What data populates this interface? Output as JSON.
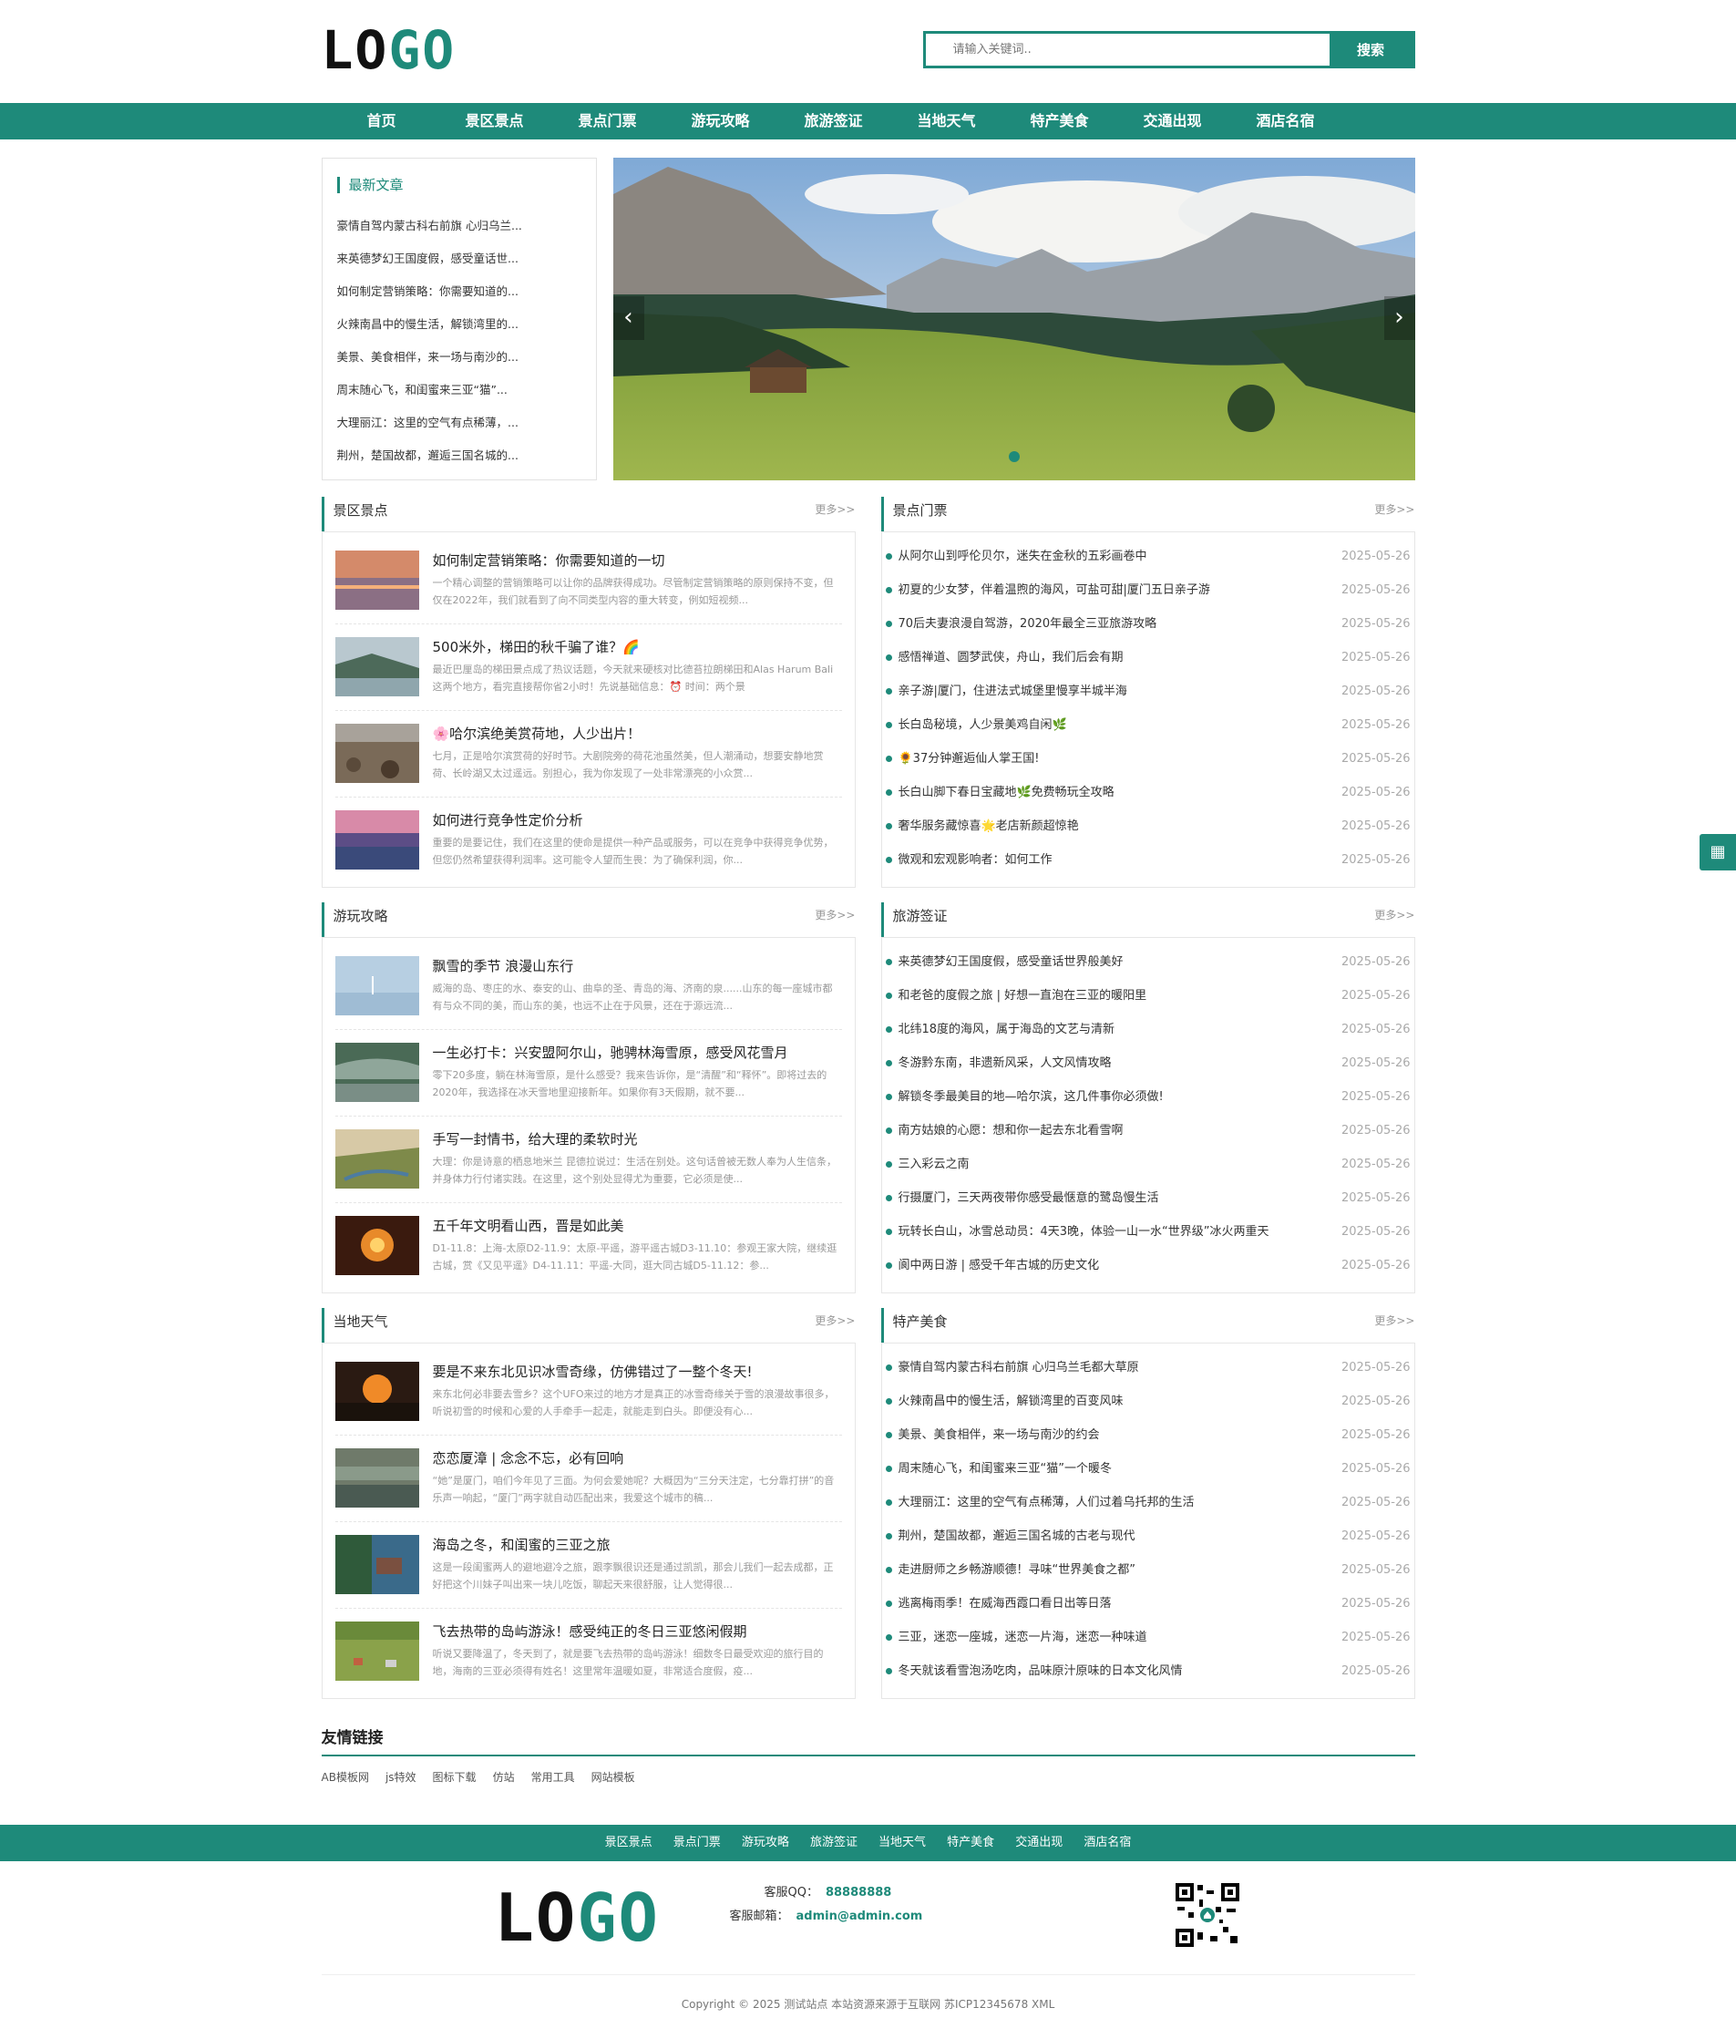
{
  "header": {
    "logo_dark": "LO",
    "logo_accent": "GO",
    "search_placeholder": "请输入关键词..",
    "search_button": "搜索"
  },
  "nav": [
    "首页",
    "景区景点",
    "景点门票",
    "游玩攻略",
    "旅游签证",
    "当地天气",
    "特产美食",
    "交通出现",
    "酒店名宿"
  ],
  "latest": {
    "title": "最新文章",
    "items": [
      "豪情自驾内蒙古科右前旗 心归乌兰...",
      "来英德梦幻王国度假，感受童话世...",
      "如何制定营销策略：你需要知道的...",
      "火辣南昌中的慢生活，解锁湾里的...",
      "美景、美食相伴，来一场与南沙的...",
      "周末随心飞，和闺蜜来三亚“猫”...",
      "大理丽江：这里的空气有点稀薄，...",
      "荆州，楚国故都，邂逅三国名城的..."
    ]
  },
  "more": "更多>>",
  "sections": {
    "scenic": {
      "title": "景区景点",
      "articles": [
        {
          "title": "如何制定营销策略：你需要知道的一切",
          "desc": "一个精心调整的营销策略可以让你的品牌获得成功。尽管制定营销策略的原则保持不变，但仅在2022年，我们就看到了向不同类型内容的重大转变，例如短视频..."
        },
        {
          "title": "500米外，梯田的秋千骗了谁？🌈",
          "desc": "最近巴厘岛的梯田景点成了热议话题，今天就来硬核对比德苔拉朗梯田和Alas Harum Bali这两个地方，看完直接帮你省2小时！先说基础信息：⏰ 时间：两个景"
        },
        {
          "title": "🌸哈尔滨绝美赏荷地，人少出片！",
          "desc": "七月，正是哈尔滨赏荷的好时节。大剧院旁的荷花池虽然美，但人潮涌动，想要安静地赏荷、长岭湖又太过遥远。别担心，我为你发现了一处非常漂亮的小众赏..."
        },
        {
          "title": "如何进行竞争性定价分析",
          "desc": "重要的是要记住，我们在这里的使命是提供一种产品或服务，可以在竞争中获得竞争优势，但您仍然希望获得利润率。这可能令人望而生畏：为了确保利润，你..."
        }
      ]
    },
    "tickets": {
      "title": "景点门票",
      "items": [
        {
          "t": "从阿尔山到呼伦贝尔，迷失在金秋的五彩画卷中",
          "d": "2025-05-26"
        },
        {
          "t": "初夏的少女梦，伴着温煦的海风，可盐可甜|厦门五日亲子游",
          "d": "2025-05-26"
        },
        {
          "t": "70后夫妻浪漫自驾游，2020年最全三亚旅游攻略",
          "d": "2025-05-26"
        },
        {
          "t": "感悟禅道、圆梦武侠，舟山，我们后会有期",
          "d": "2025-05-26"
        },
        {
          "t": "亲子游|厦门，住进法式城堡里慢享半城半海",
          "d": "2025-05-26"
        },
        {
          "t": "长白岛秘境，人少景美鸡自闲🌿",
          "d": "2025-05-26"
        },
        {
          "t": "🌻37分钟邂逅仙人掌王国!",
          "d": "2025-05-26"
        },
        {
          "t": "长白山脚下春日宝藏地🌿免费畅玩全攻略",
          "d": "2025-05-26"
        },
        {
          "t": "奢华服务藏惊喜🌟老店新颜超惊艳",
          "d": "2025-05-26"
        },
        {
          "t": "微观和宏观影响者：如何工作",
          "d": "2025-05-26"
        }
      ]
    },
    "guide": {
      "title": "游玩攻略",
      "articles": [
        {
          "title": "飘雪的季节 浪漫山东行",
          "desc": "威海的岛、枣庄的水、泰安的山、曲阜的圣、青岛的海、济南的泉......山东的每一座城市都有与众不同的美，而山东的美，也远不止在于风景，还在于源远流..."
        },
        {
          "title": "一生必打卡：兴安盟阿尔山，驰骋林海雪原，感受风花雪月",
          "desc": "零下20多度，躺在林海雪原，是什么感受？我来告诉你，是“清醒”和“释怀”。即将过去的2020年，我选择在冰天雪地里迎接新年。如果你有3天假期，就不要..."
        },
        {
          "title": "手写一封情书，给大理的柔软时光",
          "desc": "大理：你是诗意的栖息地米兰 昆德拉说过：生活在别处。这句话曾被无数人奉为人生信条，并身体力行付诸实践。在这里，这个别处显得尤为重要，它必须是使..."
        },
        {
          "title": "五千年文明看山西，晋是如此美",
          "desc": "D1-11.8：上海-太原D2-11.9：太原-平遥，游平遥古城D3-11.10：参观王家大院，继续逛古城，赏《又见平遥》D4-11.11：平遥-大同，逛大同古城D5-11.12：参..."
        }
      ]
    },
    "visa": {
      "title": "旅游签证",
      "items": [
        {
          "t": "来英德梦幻王国度假，感受童话世界般美好",
          "d": "2025-05-26"
        },
        {
          "t": "和老爸的度假之旅 | 好想一直泡在三亚的暖阳里",
          "d": "2025-05-26"
        },
        {
          "t": "北纬18度的海风，属于海岛的文艺与清新",
          "d": "2025-05-26"
        },
        {
          "t": "冬游黔东南，非遗新风采，人文风情攻略",
          "d": "2025-05-26"
        },
        {
          "t": "解锁冬季最美目的地—哈尔滨，这几件事你必须做!",
          "d": "2025-05-26"
        },
        {
          "t": "南方姑娘的心愿：想和你一起去东北看雪啊",
          "d": "2025-05-26"
        },
        {
          "t": "三入彩云之南",
          "d": "2025-05-26"
        },
        {
          "t": "行摄厦门，三天两夜带你感受最惬意的鹭岛慢生活",
          "d": "2025-05-26"
        },
        {
          "t": "玩转长白山，冰雪总动员：4天3晚，体验一山一水“世界级”冰火两重天",
          "d": "2025-05-26"
        },
        {
          "t": "阆中两日游 | 感受千年古城的历史文化",
          "d": "2025-05-26"
        }
      ]
    },
    "weather": {
      "title": "当地天气",
      "articles": [
        {
          "title": "要是不来东北见识冰雪奇缘，仿佛错过了一整个冬天!",
          "desc": "来东北何必非要去雪乡？这个UFO来过的地方才是真正的冰雪奇缘关于雪的浪漫故事很多，听说初雪的时候和心爱的人手牵手一起走，就能走到白头。即便没有心..."
        },
        {
          "title": "恋恋厦漳 | 念念不忘，必有回响",
          "desc": "“她”是厦门，咱们今年见了三面。为何会爱她呢？大概因为“三分天注定，七分靠打拼”的音乐声一响起，“厦门”两字就自动匹配出来，我爱这个城市的稿..."
        },
        {
          "title": "海岛之冬，和闺蜜的三亚之旅",
          "desc": "这是一段闺蜜两人的避地避冷之旅，跟李飘很识还是通过凯凯，那会儿我们一起去成都，正好把这个川妹子叫出来一块儿吃饭，聊起天来很舒服，让人觉得很..."
        },
        {
          "title": "飞去热带的岛屿游泳！感受纯正的冬日三亚悠闲假期",
          "desc": "听说又要降温了，冬天到了，就是要飞去热带的岛屿游泳！细数冬日最受欢迎的旅行目的地，海南的三亚必须得有姓名！这里常年温暖如夏，非常适合度假，疫..."
        }
      ]
    },
    "food": {
      "title": "特产美食",
      "items": [
        {
          "t": "豪情自驾内蒙古科右前旗 心归乌兰毛都大草原",
          "d": "2025-05-26"
        },
        {
          "t": "火辣南昌中的慢生活，解锁湾里的百变风味",
          "d": "2025-05-26"
        },
        {
          "t": "美景、美食相伴，来一场与南沙的约会",
          "d": "2025-05-26"
        },
        {
          "t": "周末随心飞，和闺蜜来三亚“猫”一个暖冬",
          "d": "2025-05-26"
        },
        {
          "t": "大理丽江：这里的空气有点稀薄，人们过着乌托邦的生活",
          "d": "2025-05-26"
        },
        {
          "t": "荆州，楚国故都，邂逅三国名城的古老与现代",
          "d": "2025-05-26"
        },
        {
          "t": "走进厨师之乡畅游顺德！寻味“世界美食之都”",
          "d": "2025-05-26"
        },
        {
          "t": "逃离梅雨季！在威海西霞口看日出等日落",
          "d": "2025-05-26"
        },
        {
          "t": "三亚，迷恋一座城，迷恋一片海，迷恋一种味道",
          "d": "2025-05-26"
        },
        {
          "t": "冬天就该看雪泡汤吃肉，品味原汁原味的日本文化风情",
          "d": "2025-05-26"
        }
      ]
    }
  },
  "links": {
    "title": "友情链接",
    "items": [
      "AB模板网",
      "js特效",
      "图标下载",
      "仿站",
      "常用工具",
      "网站模板"
    ]
  },
  "footer": {
    "nav": [
      "景区景点",
      "景点门票",
      "游玩攻略",
      "旅游签证",
      "当地天气",
      "特产美食",
      "交通出现",
      "酒店名宿"
    ],
    "qq_label": "客服QQ：",
    "qq": "88888888",
    "email_label": "客服邮箱：",
    "email": "admin@admin.com",
    "copyright": "Copyright © 2025 测试站点 本站资源来源于互联网 苏ICP12345678 XML"
  },
  "colors": {
    "accent": "#1e8a7a"
  }
}
